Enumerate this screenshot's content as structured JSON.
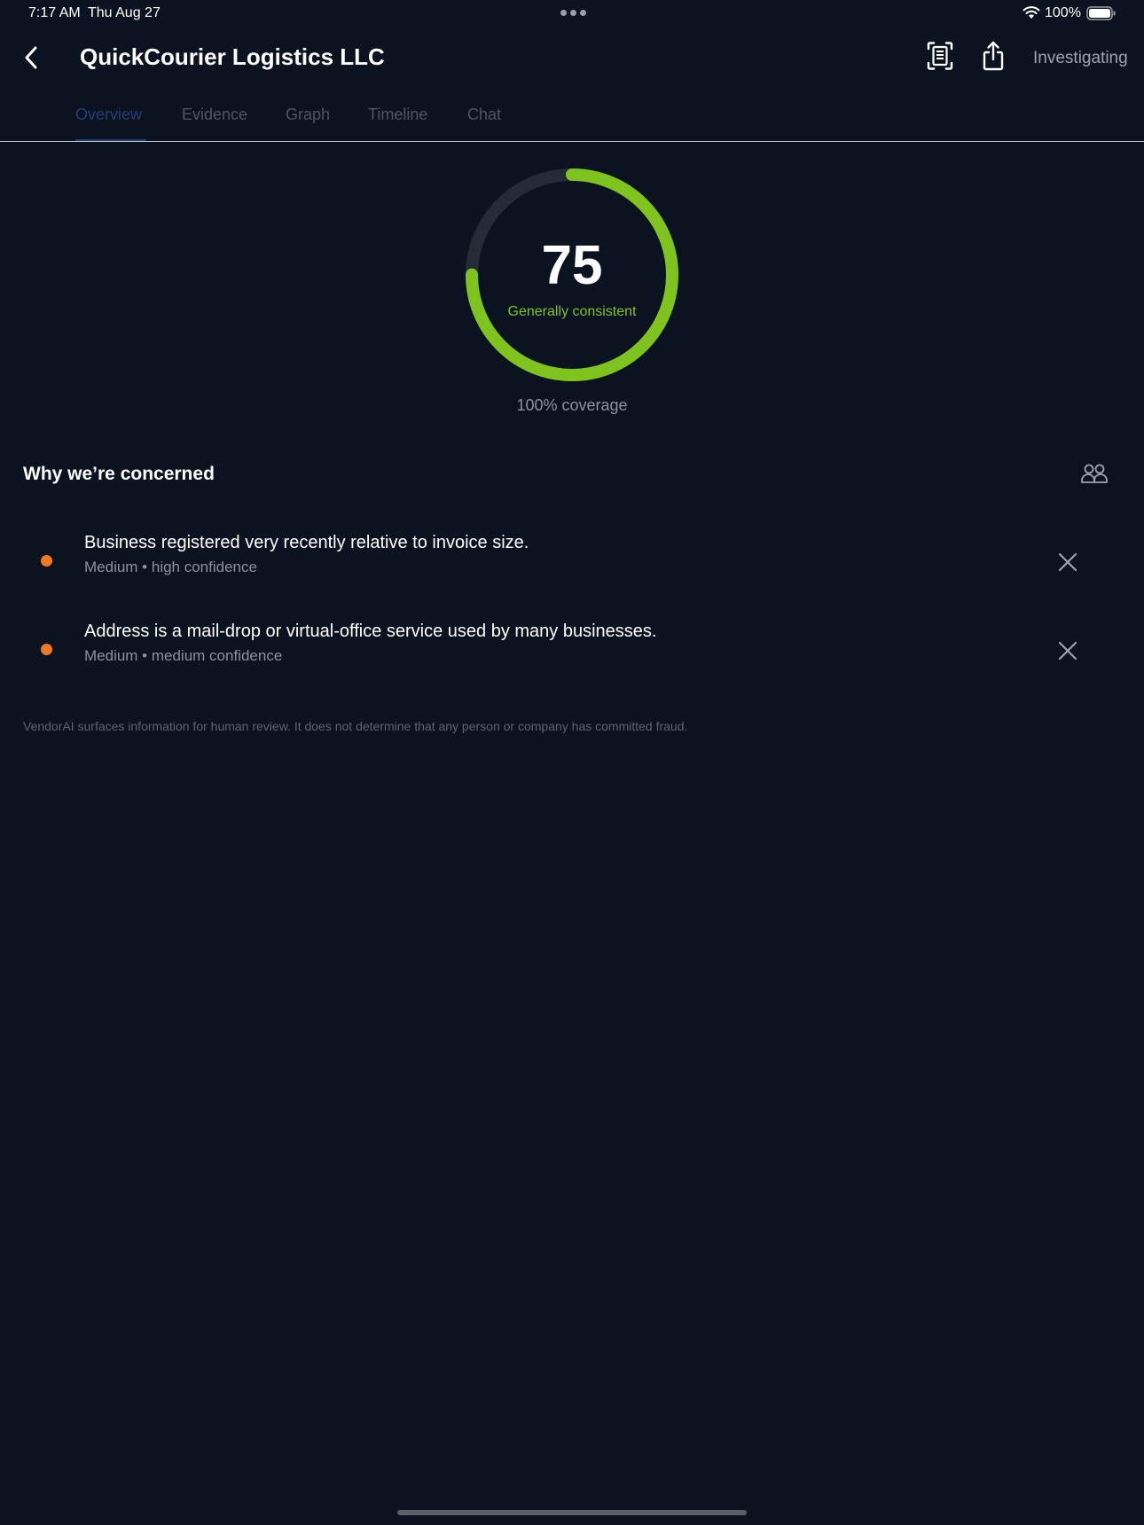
{
  "status_bar": {
    "time": "7:17 AM",
    "date": "Thu Aug 27",
    "battery": "100%",
    "icons": [
      "wifi-icon",
      "battery-icon"
    ]
  },
  "header": {
    "title": "QuickCourier Logistics LLC",
    "status": "Investigating",
    "icons": [
      "back-chevron-icon",
      "document-scan-icon",
      "share-icon"
    ]
  },
  "tabs": [
    {
      "label": "Overview",
      "active": true
    },
    {
      "label": "Evidence",
      "active": false
    },
    {
      "label": "Graph",
      "active": false
    },
    {
      "label": "Timeline",
      "active": false
    },
    {
      "label": "Chat",
      "active": false
    }
  ],
  "score": {
    "value": 75,
    "value_text": "75",
    "label": "Generally consistent",
    "coverage": "100% coverage",
    "fraction": 0.75,
    "color": "#7fc31f",
    "track_color": "#262c37"
  },
  "concerns": {
    "title": "Why we’re concerned",
    "icon": "people-icon",
    "items": [
      {
        "title": "Business registered very recently relative to invoice size.",
        "meta": "Medium • high confidence",
        "severity_color": "#f07a24"
      },
      {
        "title": "Address is a mail-drop or virtual-office service used by many businesses.",
        "meta": "Medium • medium confidence",
        "severity_color": "#f07a24"
      }
    ]
  },
  "disclaimer": "VendorAI surfaces information for human review. It does not determine that any person or company has committed fraud.",
  "colors": {
    "background": "#0b1220",
    "accent": "#7fc31f",
    "active_tab": "#233f72",
    "severity_medium": "#f07a24"
  }
}
